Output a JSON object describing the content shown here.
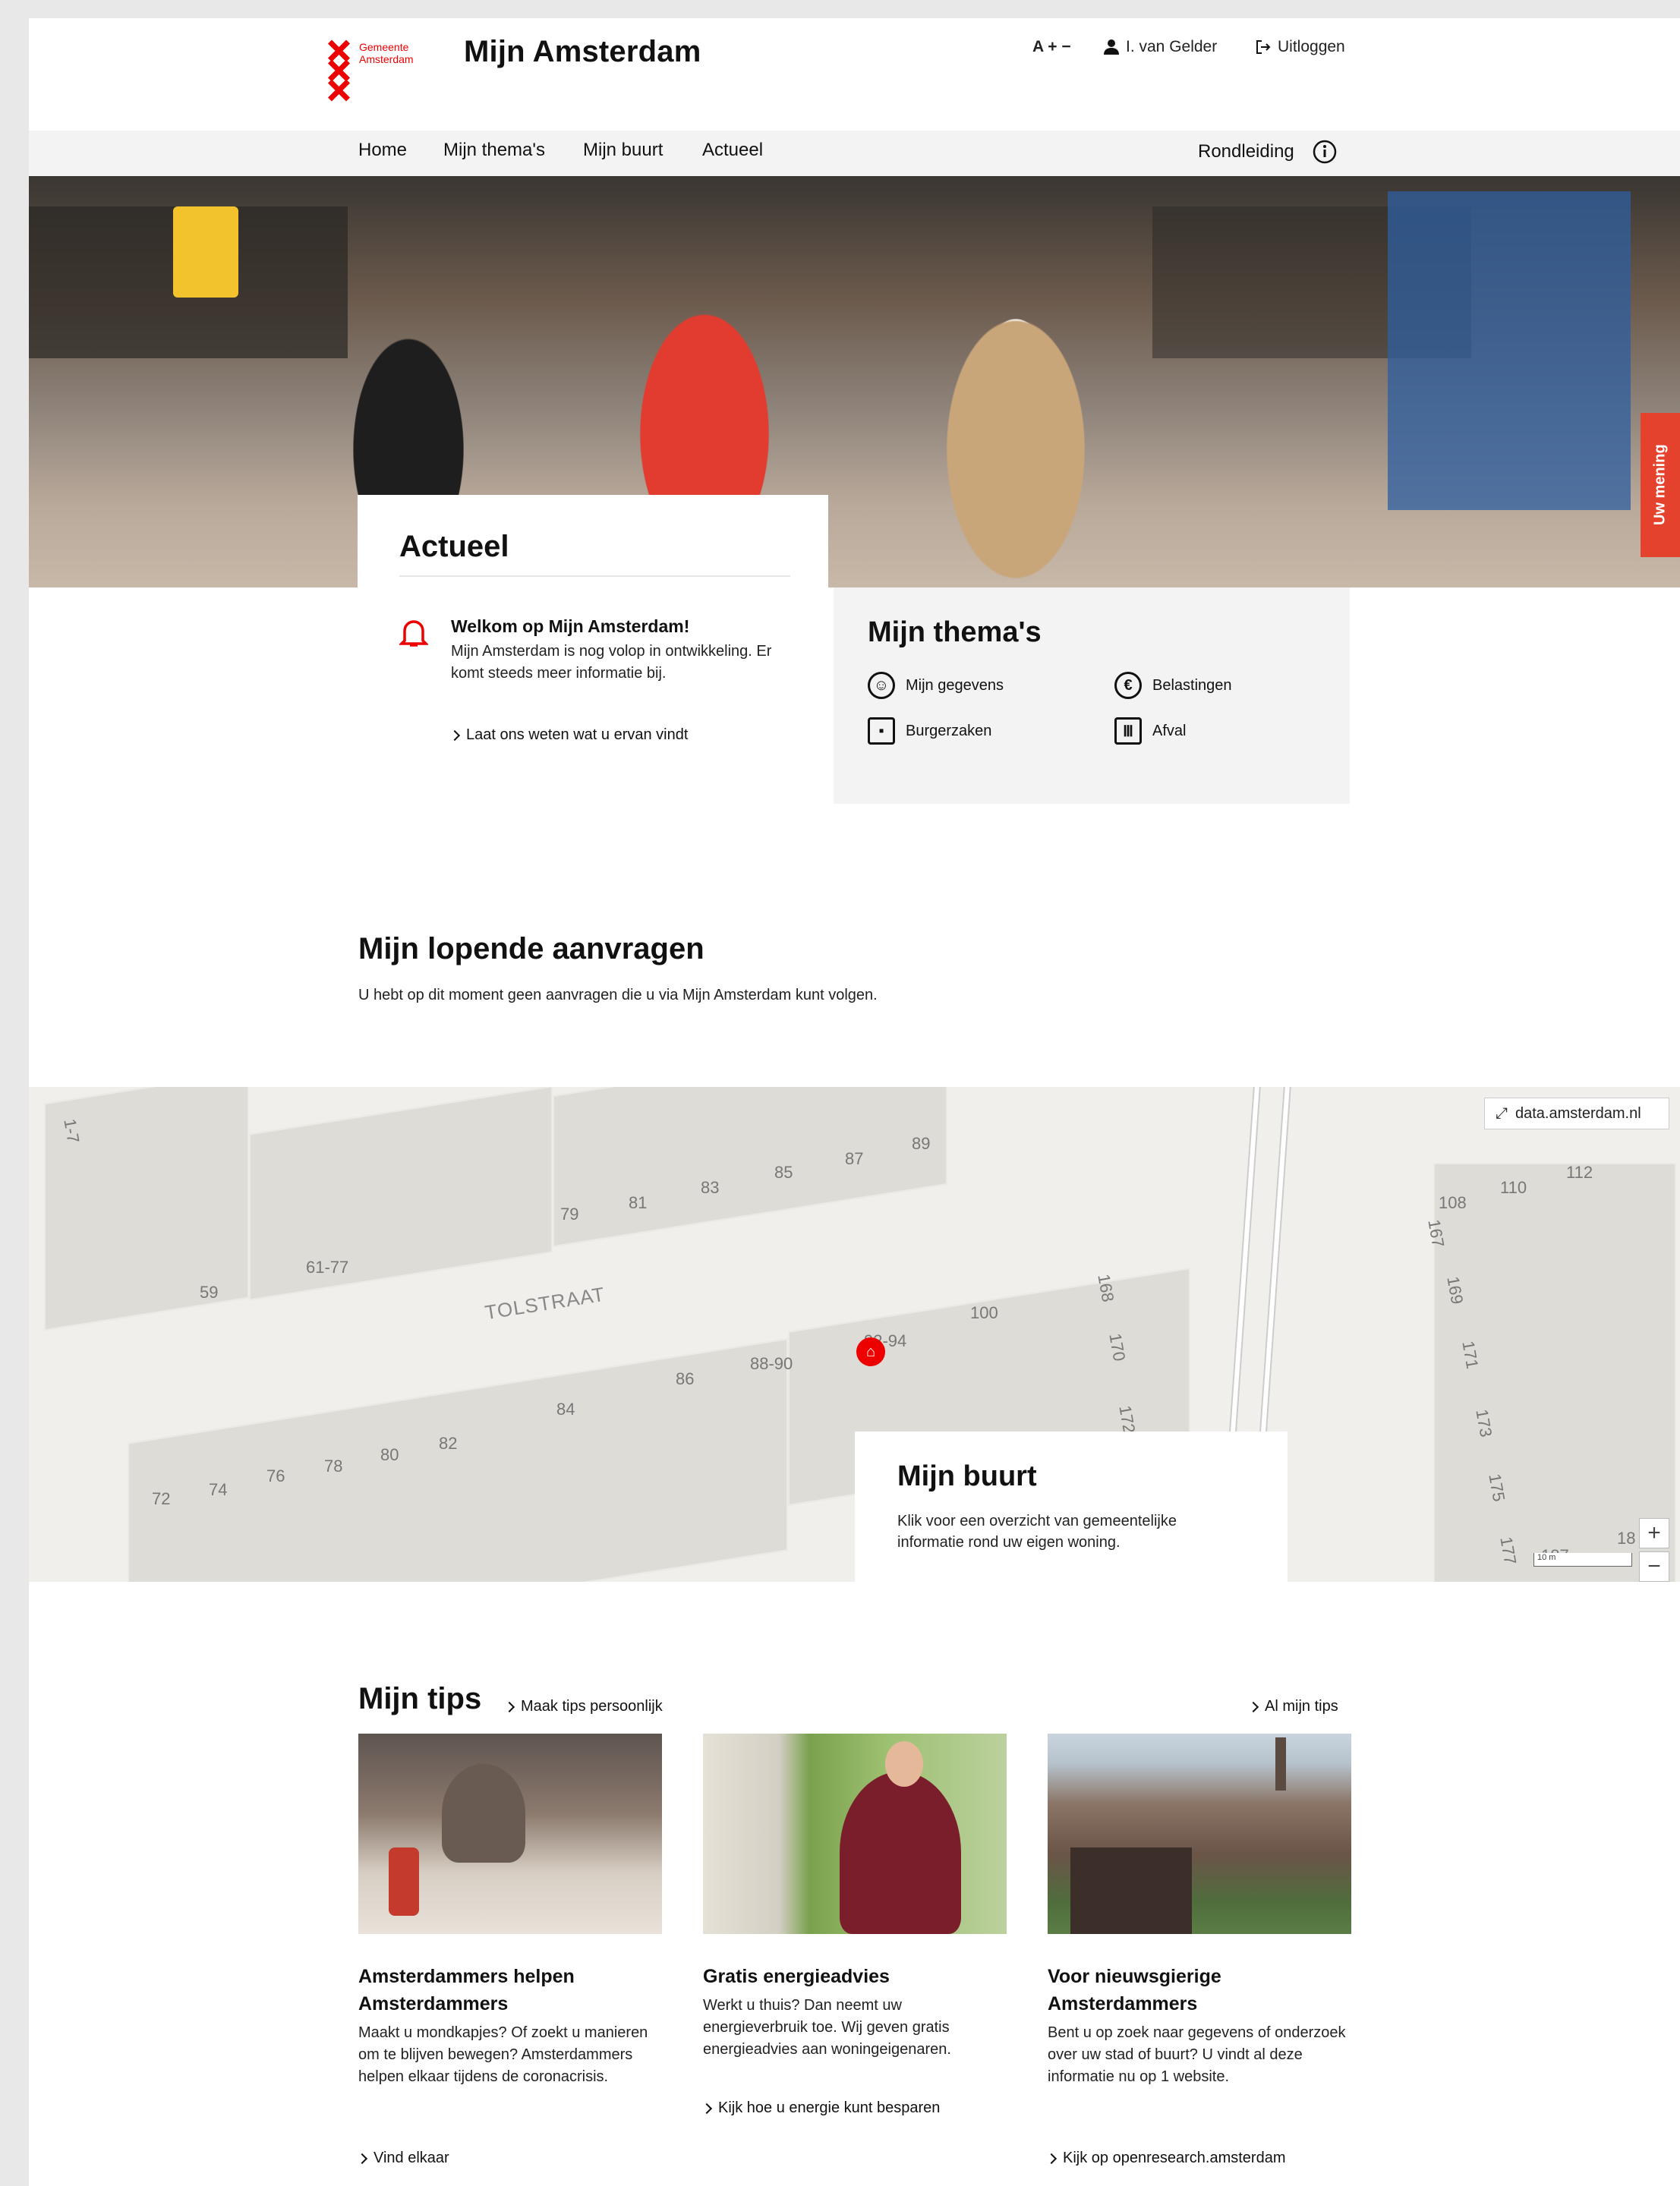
{
  "header": {
    "logo_text": "Gemeente Amsterdam",
    "site_title": "Mijn Amsterdam",
    "font_size_toggle": "A + −",
    "user_name": "I. van Gelder",
    "logout_label": "Uitloggen"
  },
  "nav": {
    "items": [
      "Home",
      "Mijn thema's",
      "Mijn buurt",
      "Actueel"
    ],
    "tour_label": "Rondleiding"
  },
  "feedback_tab": "Uw mening",
  "actueel": {
    "title": "Actueel",
    "notification_title": "Welkom op Mijn Amsterdam!",
    "notification_body": "Mijn Amsterdam is nog volop in ontwikkeling. Er komt steeds meer informatie bij.",
    "notification_link": "Laat ons weten wat u ervan vindt"
  },
  "themas": {
    "title": "Mijn thema's",
    "items": [
      {
        "label": "Mijn gegevens",
        "icon": "user-circle-icon"
      },
      {
        "label": "Belastingen",
        "icon": "euro-icon"
      },
      {
        "label": "Burgerzaken",
        "icon": "id-card-icon"
      },
      {
        "label": "Afval",
        "icon": "trash-bin-icon"
      }
    ]
  },
  "aanvragen": {
    "title": "Mijn lopende aanvragen",
    "body": "U hebt op dit moment geen aanvragen die u via Mijn Amsterdam kunt volgen."
  },
  "map": {
    "source_link": "data.amsterdam.nl",
    "street_name": "TOLSTRAAT",
    "house_numbers": [
      "1-7",
      "59",
      "61-77",
      "79",
      "81",
      "83",
      "85",
      "87",
      "89",
      "72",
      "74",
      "76",
      "78",
      "80",
      "82",
      "84",
      "86",
      "88-90",
      "92-94",
      "100",
      "168",
      "170",
      "172",
      "108",
      "110",
      "112",
      "167",
      "169",
      "171",
      "173",
      "175",
      "177",
      "187",
      "18"
    ],
    "scale_label": "10 m",
    "zoom_in": "+",
    "zoom_out": "−"
  },
  "buurt": {
    "title": "Mijn buurt",
    "body": "Klik voor een overzicht van gemeentelijke informatie rond uw eigen woning."
  },
  "tips": {
    "title": "Mijn tips",
    "personalize_link": "Maak tips persoonlijk",
    "all_link": "Al mijn tips",
    "items": [
      {
        "title": "Amsterdammers helpen Amsterdammers",
        "body": "Maakt u mondkapjes? Of zoekt u manieren om te blijven bewegen? Amsterdammers helpen elkaar tijdens de coronacrisis.",
        "link": "Vind elkaar"
      },
      {
        "title": "Gratis energieadvies",
        "body": "Werkt u thuis? Dan neemt uw energieverbruik toe. Wij geven gratis energieadvies aan woningeigenaren.",
        "link": "Kijk hoe u energie kunt besparen"
      },
      {
        "title": "Voor nieuwsgierige Amsterdammers",
        "body": "Bent u op zoek naar gegevens of onderzoek over uw stad of buurt? U vindt al deze informatie nu op 1 website.",
        "link": "Kijk op openresearch.amsterdam"
      }
    ]
  },
  "colors": {
    "brand_red": "#ec0000",
    "feedback_tab": "#e5422d"
  }
}
